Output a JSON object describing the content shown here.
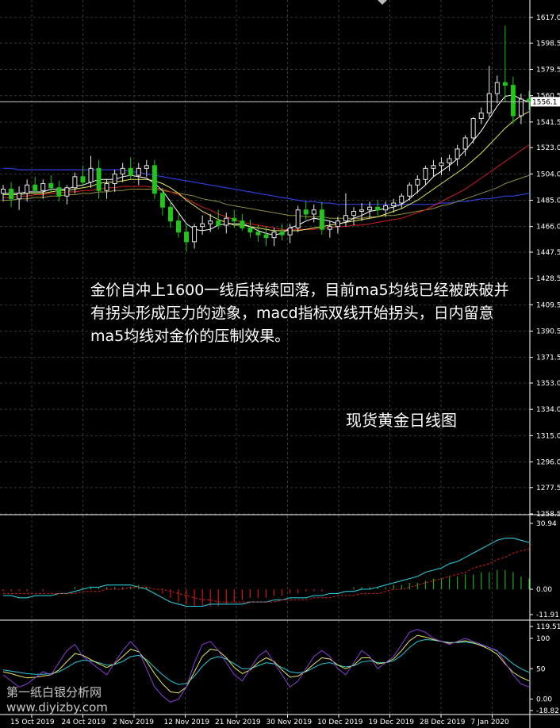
{
  "annotation": "金价自冲上1600一线后持续回落，目前ma5均线已经被跌破并有拐头形成压力的迹象，macd指标双线开始拐头，日内留意ma5均线对金价的压制效果。",
  "caption": "现货黄金日线图",
  "watermark": {
    "line1": "第一纸白银分析网",
    "line2": "www.diyizby.com"
  },
  "colors": {
    "background": "#000000",
    "up": "#e8e8e8",
    "down": "#22c41d",
    "ma_white": "#ffffff",
    "ma_yellow": "#e6e65a",
    "ma_red": "#d22020",
    "ma_olive": "#8f8f3a",
    "ma_blue": "#2d3fd8",
    "macd_line": "#28c8d8",
    "macd_signal": "#c81e1e",
    "stoch_purple": "#8a3cd8"
  },
  "chart_data": [
    {
      "type": "candlestick",
      "title": "",
      "xlabel": "",
      "ylabel": "",
      "ylim": [
        1258.5,
        1617.0
      ],
      "y_ticks": [
        "1617.0",
        "1598.5",
        "1579.5",
        "1560.5",
        "1541.5",
        "1523.0",
        "1504.0",
        "1485.0",
        "1466.0",
        "1447.5",
        "1428.5",
        "1409.5",
        "1390.5",
        "1371.5",
        "1353.0",
        "1334.0",
        "1315.0",
        "1296.0",
        "1277.5",
        "1258.5"
      ],
      "current_price": "1556.1",
      "x_labels": [
        "15 Oct 2019",
        "24 Oct 2019",
        "2 Nov 2019",
        "12 Nov 2019",
        "21 Nov 2019",
        "30 Nov 2019",
        "10 Dec 2019",
        "19 Dec 2019",
        "28 Dec 2019",
        "7 Jan 2020"
      ],
      "candles": [
        [
          1490,
          1496,
          1484,
          1493
        ],
        [
          1493,
          1498,
          1480,
          1486
        ],
        [
          1486,
          1495,
          1478,
          1490
        ],
        [
          1490,
          1500,
          1484,
          1496
        ],
        [
          1496,
          1502,
          1489,
          1492
        ],
        [
          1492,
          1500,
          1486,
          1497
        ],
        [
          1497,
          1503,
          1491,
          1494
        ],
        [
          1494,
          1499,
          1484,
          1488
        ],
        [
          1488,
          1496,
          1482,
          1494
        ],
        [
          1494,
          1505,
          1490,
          1502
        ],
        [
          1502,
          1510,
          1495,
          1498
        ],
        [
          1498,
          1517,
          1494,
          1508
        ],
        [
          1508,
          1514,
          1486,
          1492
        ],
        [
          1492,
          1500,
          1486,
          1497
        ],
        [
          1497,
          1507,
          1491,
          1504
        ],
        [
          1504,
          1512,
          1498,
          1508
        ],
        [
          1508,
          1516,
          1500,
          1503
        ],
        [
          1503,
          1512,
          1496,
          1508
        ],
        [
          1508,
          1514,
          1502,
          1510
        ],
        [
          1510,
          1514,
          1486,
          1490
        ],
        [
          1490,
          1494,
          1474,
          1480
        ],
        [
          1480,
          1484,
          1465,
          1470
        ],
        [
          1470,
          1475,
          1458,
          1462
        ],
        [
          1462,
          1467,
          1448,
          1455
        ],
        [
          1455,
          1468,
          1450,
          1466
        ],
        [
          1466,
          1474,
          1460,
          1468
        ],
        [
          1468,
          1475,
          1462,
          1470
        ],
        [
          1470,
          1478,
          1464,
          1467
        ],
        [
          1467,
          1476,
          1461,
          1472
        ],
        [
          1472,
          1478,
          1465,
          1470
        ],
        [
          1470,
          1475,
          1463,
          1465
        ],
        [
          1465,
          1471,
          1458,
          1462
        ],
        [
          1462,
          1467,
          1455,
          1460
        ],
        [
          1460,
          1466,
          1452,
          1458
        ],
        [
          1458,
          1465,
          1452,
          1462
        ],
        [
          1462,
          1468,
          1456,
          1460
        ],
        [
          1460,
          1468,
          1454,
          1465
        ],
        [
          1465,
          1481,
          1462,
          1478
        ],
        [
          1478,
          1484,
          1471,
          1475
        ],
        [
          1475,
          1482,
          1469,
          1478
        ],
        [
          1478,
          1484,
          1460,
          1464
        ],
        [
          1464,
          1470,
          1458,
          1466
        ],
        [
          1466,
          1473,
          1461,
          1470
        ],
        [
          1470,
          1490,
          1466,
          1474
        ],
        [
          1474,
          1480,
          1467,
          1477
        ],
        [
          1477,
          1483,
          1470,
          1478
        ],
        [
          1478,
          1484,
          1472,
          1480
        ],
        [
          1480,
          1485,
          1474,
          1478
        ],
        [
          1478,
          1484,
          1473,
          1481
        ],
        [
          1481,
          1486,
          1476,
          1483
        ],
        [
          1483,
          1490,
          1479,
          1488
        ],
        [
          1488,
          1498,
          1485,
          1496
        ],
        [
          1496,
          1503,
          1490,
          1500
        ],
        [
          1500,
          1510,
          1496,
          1508
        ],
        [
          1508,
          1514,
          1502,
          1510
        ],
        [
          1510,
          1516,
          1503,
          1512
        ],
        [
          1512,
          1518,
          1506,
          1515
        ],
        [
          1515,
          1525,
          1510,
          1522
        ],
        [
          1522,
          1532,
          1517,
          1530
        ],
        [
          1530,
          1545,
          1526,
          1544
        ],
        [
          1544,
          1552,
          1540,
          1548
        ],
        [
          1548,
          1582,
          1545,
          1562
        ],
        [
          1562,
          1575,
          1555,
          1570
        ],
        [
          1570,
          1611,
          1556,
          1568
        ],
        [
          1568,
          1574,
          1540,
          1546
        ],
        [
          1546,
          1562,
          1540,
          1558
        ],
        [
          1558,
          1564,
          1550,
          1556
        ]
      ],
      "ma_fast": [
        1490,
        1490,
        1490,
        1491,
        1491,
        1491,
        1493,
        1493,
        1493,
        1495,
        1496,
        1498,
        1500,
        1500,
        1500,
        1502,
        1503,
        1502,
        1501,
        1497,
        1492,
        1484,
        1476,
        1468,
        1464,
        1463,
        1464,
        1467,
        1468,
        1468,
        1468,
        1466,
        1463,
        1461,
        1460,
        1461,
        1465,
        1467,
        1470,
        1472,
        1471,
        1470,
        1468,
        1469,
        1472,
        1474,
        1477,
        1478,
        1479,
        1480,
        1482,
        1486,
        1491,
        1496,
        1502,
        1506,
        1510,
        1515,
        1521,
        1528,
        1535,
        1544,
        1553,
        1560,
        1561,
        1558,
        1556
      ],
      "ma_mid": [
        1489,
        1489,
        1489,
        1490,
        1490,
        1490,
        1491,
        1492,
        1492,
        1493,
        1494,
        1495,
        1497,
        1498,
        1498,
        1499,
        1500,
        1500,
        1500,
        1499,
        1497,
        1494,
        1490,
        1485,
        1481,
        1477,
        1474,
        1471,
        1469,
        1467,
        1467,
        1466,
        1465,
        1464,
        1463,
        1463,
        1463,
        1463,
        1464,
        1465,
        1466,
        1467,
        1468,
        1469,
        1470,
        1471,
        1472,
        1473,
        1475,
        1477,
        1479,
        1482,
        1485,
        1489,
        1493,
        1497,
        1501,
        1505,
        1509,
        1514,
        1519,
        1525,
        1531,
        1537,
        1542,
        1546,
        1549
      ],
      "ma_red": [
        1487,
        1487,
        1488,
        1488,
        1489,
        1489,
        1490,
        1490,
        1491,
        1491,
        1492,
        1492,
        1493,
        1494,
        1494,
        1495,
        1495,
        1495,
        1495,
        1494,
        1493,
        1491,
        1489,
        1486,
        1483,
        1480,
        1478,
        1475,
        1473,
        1471,
        1469,
        1468,
        1467,
        1466,
        1465,
        1464,
        1464,
        1464,
        1464,
        1464,
        1465,
        1465,
        1466,
        1466,
        1467,
        1467,
        1468,
        1469,
        1470,
        1471,
        1472,
        1474,
        1476,
        1478,
        1481,
        1484,
        1487,
        1490,
        1493,
        1497,
        1501,
        1505,
        1509,
        1513,
        1517,
        1521,
        1525
      ],
      "ma_olive": [
        1485,
        1485,
        1486,
        1486,
        1487,
        1487,
        1488,
        1488,
        1489,
        1489,
        1490,
        1490,
        1491,
        1491,
        1492,
        1492,
        1493,
        1493,
        1493,
        1493,
        1492,
        1491,
        1490,
        1489,
        1488,
        1486,
        1485,
        1484,
        1482,
        1481,
        1480,
        1479,
        1478,
        1477,
        1476,
        1475,
        1474,
        1474,
        1473,
        1473,
        1473,
        1472,
        1472,
        1472,
        1472,
        1472,
        1473,
        1473,
        1474,
        1474,
        1475,
        1476,
        1477,
        1478,
        1479,
        1481,
        1482,
        1484,
        1486,
        1488,
        1490,
        1492,
        1494,
        1497,
        1499,
        1501,
        1503
      ],
      "ma_blue": [
        1508,
        1508,
        1507,
        1507,
        1507,
        1507,
        1507,
        1507,
        1507,
        1507,
        1507,
        1507,
        1507,
        1507,
        1507,
        1507,
        1506,
        1505,
        1504,
        1503,
        1502,
        1501,
        1500,
        1499,
        1498,
        1497,
        1496,
        1495,
        1494,
        1493,
        1492,
        1491,
        1490,
        1489,
        1488,
        1487,
        1486,
        1485,
        1484,
        1484,
        1483,
        1483,
        1482,
        1482,
        1482,
        1482,
        1482,
        1482,
        1482,
        1482,
        1482,
        1482,
        1482,
        1482,
        1482,
        1483,
        1483,
        1484,
        1484,
        1485,
        1486,
        1486,
        1487,
        1488,
        1488,
        1489,
        1490
      ]
    },
    {
      "type": "macd",
      "title": "",
      "ylim": [
        -11.91,
        30.94
      ],
      "y_ticks": [
        "30.94",
        "0.00",
        "-11.91"
      ],
      "histogram": [
        -1,
        -1,
        -1,
        -1,
        0,
        -1,
        0,
        0,
        0,
        1,
        1,
        1,
        1,
        1,
        1,
        1,
        1,
        2,
        1,
        0,
        -2,
        -4,
        -6,
        -7,
        -8,
        -8,
        -8,
        -8,
        -7,
        -6,
        -5,
        -4,
        -4,
        -4,
        -3,
        -3,
        -2,
        -2,
        -1,
        -1,
        -1,
        0,
        0,
        0,
        1,
        1,
        1,
        1,
        1,
        2,
        2,
        3,
        3,
        4,
        5,
        5,
        6,
        6,
        7,
        7,
        8,
        8,
        9,
        9,
        8,
        6,
        5
      ],
      "macd_line": [
        -3,
        -3,
        -4,
        -4,
        -3,
        -3,
        -3,
        -2,
        -2,
        -1,
        0,
        1,
        1,
        2,
        2,
        2,
        2,
        1,
        0,
        -2,
        -4,
        -6,
        -7,
        -8,
        -8,
        -8,
        -7,
        -7,
        -7,
        -7,
        -7,
        -6,
        -6,
        -6,
        -5,
        -5,
        -4,
        -4,
        -4,
        -3,
        -3,
        -2,
        -2,
        -1,
        -1,
        0,
        0,
        1,
        2,
        3,
        4,
        5,
        6,
        8,
        9,
        10,
        12,
        13,
        15,
        17,
        19,
        21,
        23,
        24,
        24,
        23,
        22
      ],
      "signal_line": [
        -2,
        -2,
        -2,
        -2,
        -2,
        -2,
        -2,
        -2,
        -2,
        -2,
        -1,
        -1,
        -1,
        0,
        0,
        0,
        1,
        1,
        1,
        0,
        0,
        -1,
        -2,
        -3,
        -4,
        -5,
        -5,
        -6,
        -6,
        -6,
        -6,
        -6,
        -6,
        -6,
        -6,
        -5,
        -5,
        -5,
        -5,
        -4,
        -4,
        -4,
        -3,
        -3,
        -3,
        -2,
        -2,
        -2,
        -1,
        0,
        0,
        1,
        2,
        3,
        4,
        5,
        6,
        7,
        8,
        10,
        11,
        12,
        14,
        15,
        17,
        18,
        19
      ]
    },
    {
      "type": "stochastic",
      "title": "",
      "ylim": [
        -18.82,
        119.52
      ],
      "y_ticks": [
        "119.516",
        "100",
        "50",
        "0.00",
        "-18.821"
      ],
      "purple": [
        40,
        30,
        20,
        25,
        35,
        45,
        40,
        60,
        80,
        90,
        70,
        60,
        50,
        40,
        60,
        80,
        95,
        80,
        50,
        20,
        5,
        -5,
        0,
        20,
        60,
        90,
        95,
        80,
        60,
        40,
        30,
        50,
        70,
        80,
        60,
        40,
        20,
        30,
        50,
        70,
        80,
        70,
        50,
        40,
        60,
        80,
        70,
        50,
        60,
        70,
        90,
        110,
        115,
        110,
        100,
        95,
        90,
        95,
        100,
        95,
        90,
        85,
        80,
        60,
        40,
        25,
        20
      ],
      "yellow": [
        45,
        42,
        38,
        35,
        36,
        38,
        40,
        48,
        62,
        75,
        72,
        65,
        58,
        52,
        58,
        70,
        82,
        78,
        62,
        42,
        25,
        12,
        10,
        20,
        45,
        70,
        82,
        80,
        68,
        52,
        42,
        48,
        60,
        68,
        62,
        48,
        36,
        38,
        46,
        58,
        68,
        66,
        56,
        50,
        56,
        68,
        68,
        58,
        60,
        66,
        80,
        96,
        105,
        102,
        98,
        95,
        92,
        94,
        96,
        93,
        88,
        82,
        74,
        58,
        44,
        36,
        30
      ],
      "cyan": [
        48,
        46,
        44,
        42,
        41,
        41,
        42,
        45,
        52,
        60,
        64,
        63,
        60,
        56,
        57,
        62,
        70,
        72,
        65,
        52,
        40,
        30,
        24,
        26,
        38,
        54,
        66,
        70,
        66,
        58,
        50,
        50,
        55,
        60,
        58,
        52,
        45,
        43,
        45,
        52,
        58,
        60,
        56,
        53,
        55,
        61,
        63,
        60,
        60,
        63,
        72,
        85,
        95,
        98,
        97,
        95,
        93,
        93,
        94,
        92,
        89,
        85,
        79,
        69,
        58,
        50,
        44
      ]
    }
  ]
}
